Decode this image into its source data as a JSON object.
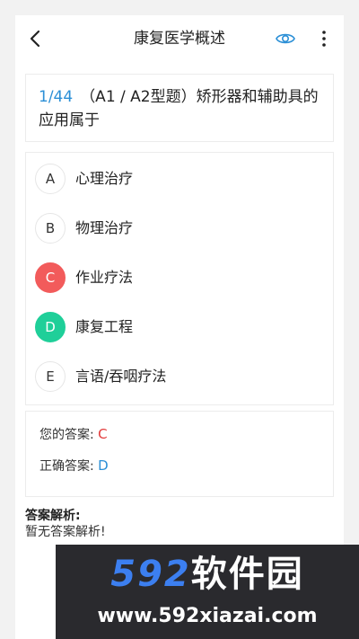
{
  "header": {
    "title": "康复医学概述"
  },
  "question": {
    "number": "1/44",
    "text": "（A1 / A2型题）矫形器和辅助具的应用属于"
  },
  "options": [
    {
      "letter": "A",
      "text": "心理治疗",
      "state": "normal"
    },
    {
      "letter": "B",
      "text": "物理治疗",
      "state": "normal"
    },
    {
      "letter": "C",
      "text": "作业疗法",
      "state": "wrong"
    },
    {
      "letter": "D",
      "text": "康复工程",
      "state": "right"
    },
    {
      "letter": "E",
      "text": "言语/吞咽疗法",
      "state": "normal"
    }
  ],
  "answers": {
    "yours_label": "您的答案:",
    "yours_value": "C",
    "correct_label": "正确答案:",
    "correct_value": "D"
  },
  "analysis": {
    "title": "答案解析:",
    "text": "暂无答案解析!"
  },
  "watermark": {
    "number": "592",
    "brand": "软件园",
    "url": "www.592xiazai.com"
  },
  "colors": {
    "accent": "#2b8fd6",
    "wrong": "#f25b5b",
    "right": "#1fcf99"
  }
}
